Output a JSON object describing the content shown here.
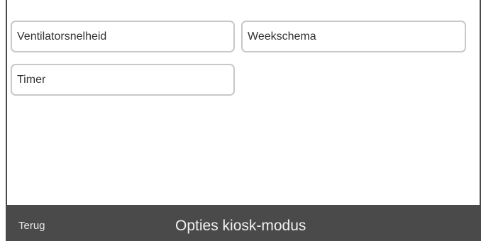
{
  "options": {
    "items": [
      {
        "label": "Ventilatorsnelheid"
      },
      {
        "label": "Weekschema"
      },
      {
        "label": "Timer"
      }
    ]
  },
  "footer": {
    "back_label": "Terug",
    "title": "Opties kiosk-modus"
  },
  "colors": {
    "background": "#ffffff",
    "footer_bar": "#4a4a4a",
    "button_border": "#c8c8c8",
    "footer_text": "#f0f0f0"
  }
}
